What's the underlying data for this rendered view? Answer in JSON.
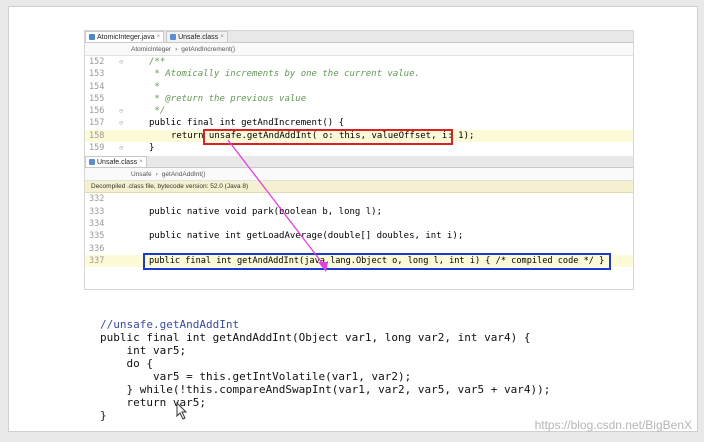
{
  "top_tabs": [
    {
      "label": "AtomicInteger.java",
      "close": "×"
    },
    {
      "label": "Unsafe.class",
      "close": "×"
    }
  ],
  "top_crumbs": [
    "AtomicInteger",
    "›",
    "getAndIncrement()"
  ],
  "top_lines": [
    {
      "n": "152",
      "t": "/**"
    },
    {
      "n": "153",
      "t": " * Atomically increments by one the current value."
    },
    {
      "n": "154",
      "t": " *"
    },
    {
      "n": "155",
      "t": " * @return the previous value"
    },
    {
      "n": "156",
      "t": " */"
    },
    {
      "n": "157",
      "t": "public final int getAndIncrement() {"
    },
    {
      "n": "158",
      "t": "return unsafe.getAndAddInt( o: this, valueOffset, i: 1);"
    },
    {
      "n": "159",
      "t": "}"
    }
  ],
  "bottom_tab": {
    "label": "Unsafe.class",
    "close": "×"
  },
  "bottom_crumbs": [
    "Unsafe",
    "›",
    "getAndAddInt()"
  ],
  "banner": "Decompiled .class file, bytecode version: 52.0 (Java 8)",
  "bottom_lines": [
    {
      "n": "332",
      "t": ""
    },
    {
      "n": "333",
      "t": "public native void park(boolean b, long l);"
    },
    {
      "n": "334",
      "t": ""
    },
    {
      "n": "335",
      "t": "public native int getLoadAverage(double[] doubles, int i);"
    },
    {
      "n": "336",
      "t": ""
    },
    {
      "n": "337",
      "t": "public final int getAndAddInt(java.lang.Object o, long l, int i) { /* compiled code */ }"
    }
  ],
  "snippet": [
    "//unsafe.getAndAddInt",
    "public final int getAndAddInt(Object var1, long var2, int var4) {",
    "    int var5;",
    "    do {",
    "        var5 = this.getIntVolatile(var1, var2);",
    "    } while(!this.compareAndSwapInt(var1, var2, var5, var5 + var4));",
    "    return var5;",
    "}"
  ],
  "watermark": "https://blog.csdn.net/BigBenX",
  "colors": {
    "red_box": "#e02020",
    "blue_box": "#1b3bd0",
    "arrow": "#e040e0"
  }
}
